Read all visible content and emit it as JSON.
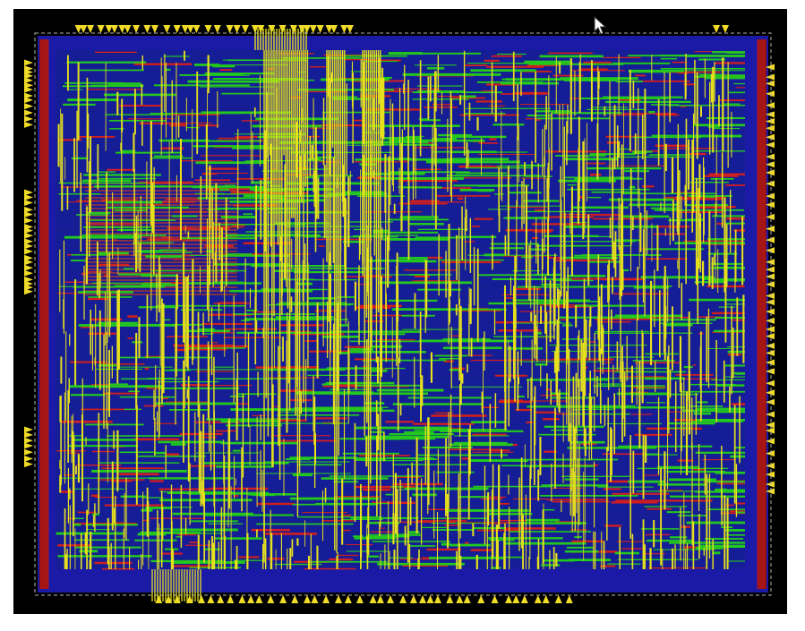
{
  "colors": {
    "background": "#000000",
    "page": "#ffffff",
    "metal1_blue": "#1a1aa6",
    "metal2_red": "#d21e1e",
    "metal3_green": "#22c81e",
    "metal4_yellow": "#e6e01e",
    "pin_yellow": "#f0dc28",
    "die_outline": "#b4b4b4",
    "dark_red": "#8a1010"
  },
  "icons": {
    "cursor": "mouse-pointer-icon",
    "pin": "io-pin-triangle-icon"
  },
  "pins": {
    "top_count": 34,
    "bottom_count": 40,
    "left_count": 42,
    "right_count": 46
  }
}
